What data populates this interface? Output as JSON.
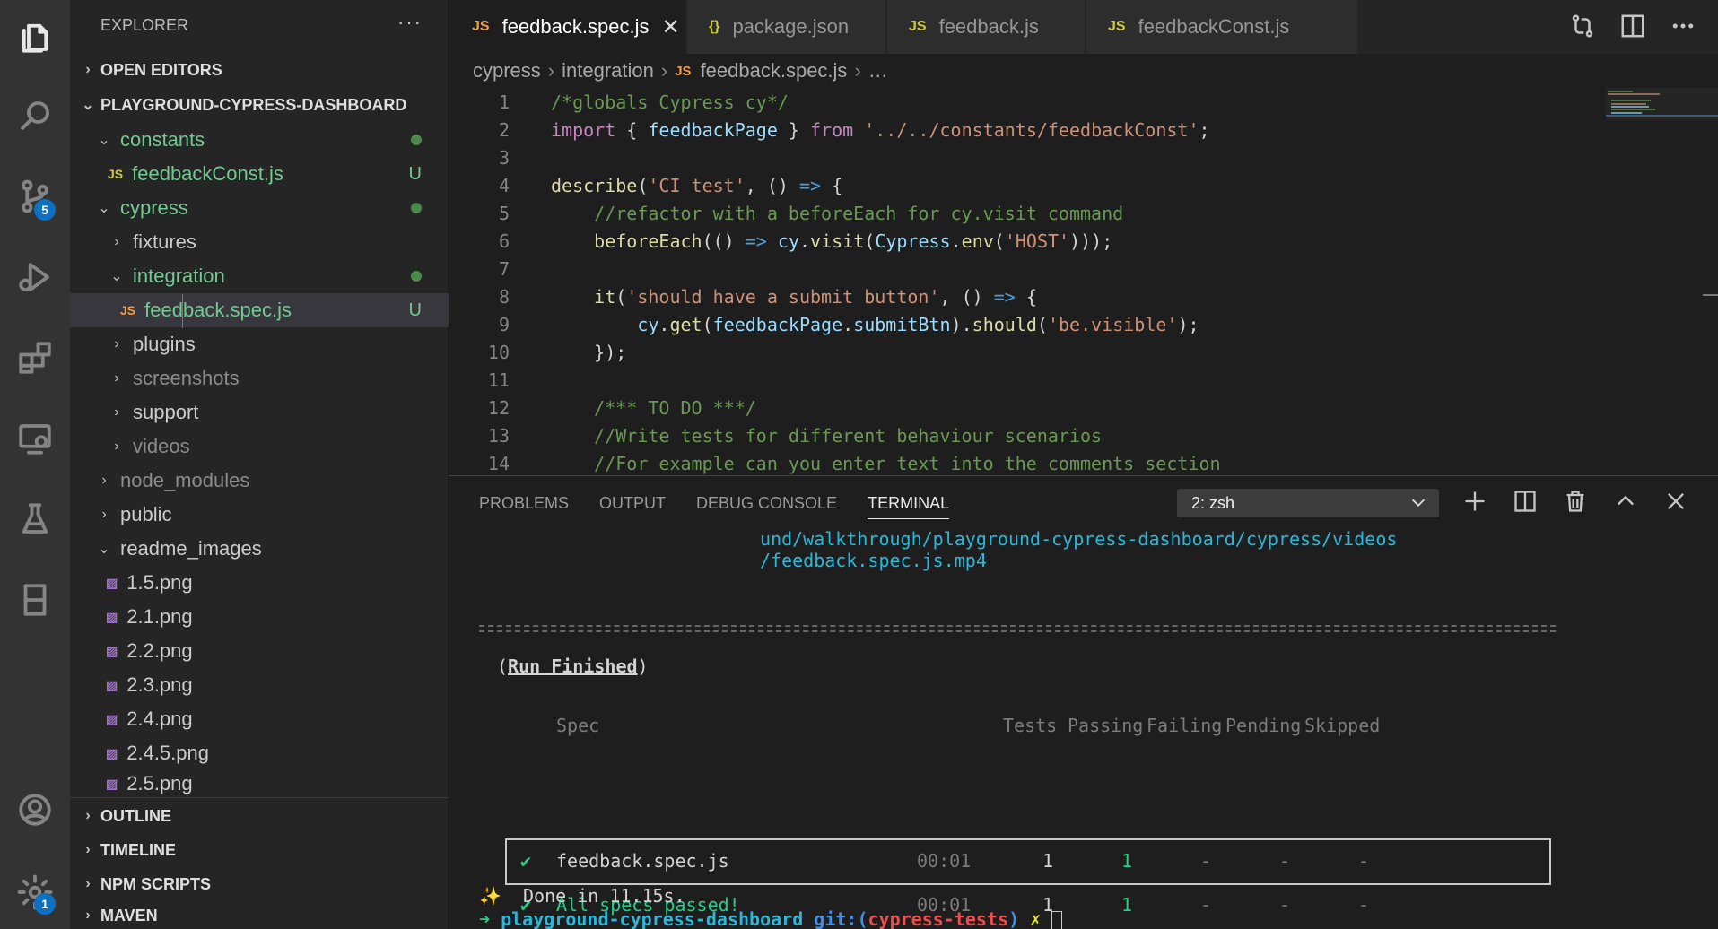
{
  "activity_bar": {
    "scm_badge": "5",
    "settings_badge": "1"
  },
  "sidebar": {
    "title": "EXPLORER",
    "more": "···",
    "open_editors": "OPEN EDITORS",
    "root": "PLAYGROUND-CYPRESS-DASHBOARD",
    "tree": [
      {
        "label": "constants",
        "icon": "",
        "status": ""
      },
      {
        "label": "feedbackConst.js",
        "icon": "JS",
        "status": "U"
      },
      {
        "label": "cypress",
        "icon": "",
        "status": ""
      },
      {
        "label": "fixtures",
        "icon": "",
        "status": ""
      },
      {
        "label": "integration",
        "icon": "",
        "status": ""
      },
      {
        "label": "feedback.spec.js",
        "icon": "JS",
        "status": "U"
      },
      {
        "label": "plugins",
        "icon": "",
        "status": ""
      },
      {
        "label": "screenshots",
        "icon": "",
        "status": ""
      },
      {
        "label": "support",
        "icon": "",
        "status": ""
      },
      {
        "label": "videos",
        "icon": "",
        "status": ""
      },
      {
        "label": "node_modules",
        "icon": "",
        "status": ""
      },
      {
        "label": "public",
        "icon": "",
        "status": ""
      },
      {
        "label": "readme_images",
        "icon": "",
        "status": ""
      },
      {
        "label": "1.5.png"
      },
      {
        "label": "2.1.png"
      },
      {
        "label": "2.2.png"
      },
      {
        "label": "2.3.png"
      },
      {
        "label": "2.4.png"
      },
      {
        "label": "2.4.5.png"
      },
      {
        "label": "2.5.png"
      }
    ],
    "sections": [
      "OUTLINE",
      "TIMELINE",
      "NPM SCRIPTS",
      "MAVEN"
    ]
  },
  "tabs": [
    {
      "icon": "JS",
      "label": "feedback.spec.js",
      "close": "✕"
    },
    {
      "icon": "{}",
      "label": "package.json"
    },
    {
      "icon": "JS",
      "label": "feedback.js"
    },
    {
      "icon": "JS",
      "label": "feedbackConst.js"
    }
  ],
  "breadcrumb": {
    "parts": [
      "cypress",
      "integration",
      "feedback.spec.js",
      "…"
    ],
    "file_icon": "JS"
  },
  "editor": {
    "line_numbers": [
      "1",
      "2",
      "3",
      "4",
      "5",
      "6",
      "7",
      "8",
      "9",
      "10",
      "11",
      "12",
      "13",
      "14"
    ]
  },
  "panel": {
    "tabs": [
      "PROBLEMS",
      "OUTPUT",
      "DEBUG CONSOLE",
      "TERMINAL"
    ],
    "terminal_select": "2: zsh",
    "lines": {
      "path1": "und/walkthrough/playground-cypress-dashboard/cypress/videos",
      "path2": "/feedback.spec.js.mp4",
      "run_finished": "Run Finished",
      "open_paren": "(",
      "close_paren": ")"
    },
    "table": {
      "headers": [
        "Spec",
        "Tests",
        "Passing",
        "Failing",
        "Pending",
        "Skipped"
      ],
      "row": {
        "check": "✔",
        "spec": "feedback.spec.js",
        "time": "00:01",
        "tests": "1",
        "passing": "1",
        "failing": "-",
        "pending": "-",
        "skipped": "-"
      },
      "summary": {
        "check": "✔",
        "label": "All specs passed!",
        "time": "00:01",
        "tests": "1",
        "passing": "1",
        "failing": "-",
        "pending": "-",
        "skipped": "-"
      }
    },
    "done": {
      "sparkle": "✨",
      "text": "Done in 11.15s."
    },
    "prompt": {
      "arrow": "➜",
      "dir": "playground-cypress-dashboard",
      "git": "git:(",
      "branch": "cypress-tests",
      "git_close": ")",
      "dirty": "✗"
    }
  }
}
